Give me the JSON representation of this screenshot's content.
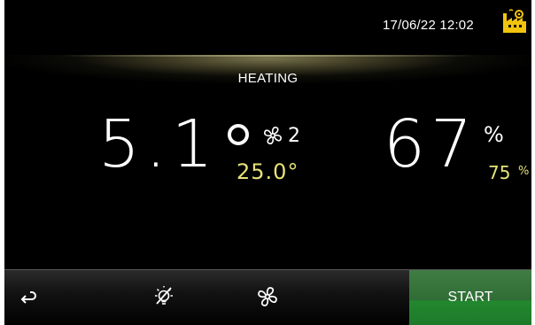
{
  "header": {
    "datetime": "17/06/22 12:02",
    "status_icon": "factory-icon"
  },
  "mode": {
    "label": "HEATING"
  },
  "temperature": {
    "value": "5.1",
    "setpoint": "25.0°",
    "fan_speed": "2"
  },
  "humidity": {
    "value": "67",
    "unit": "%",
    "setpoint": "75",
    "setpoint_unit": "%"
  },
  "bottom_bar": {
    "back_icon": "back-arrow-icon",
    "light_icon": "light-off-icon",
    "fan_icon": "fan-icon",
    "start_label": "START"
  },
  "colors": {
    "background": "#000000",
    "setpoint": "#e6e27a",
    "start_button": "#2f6d35",
    "icon_accent": "#f2c40f"
  }
}
